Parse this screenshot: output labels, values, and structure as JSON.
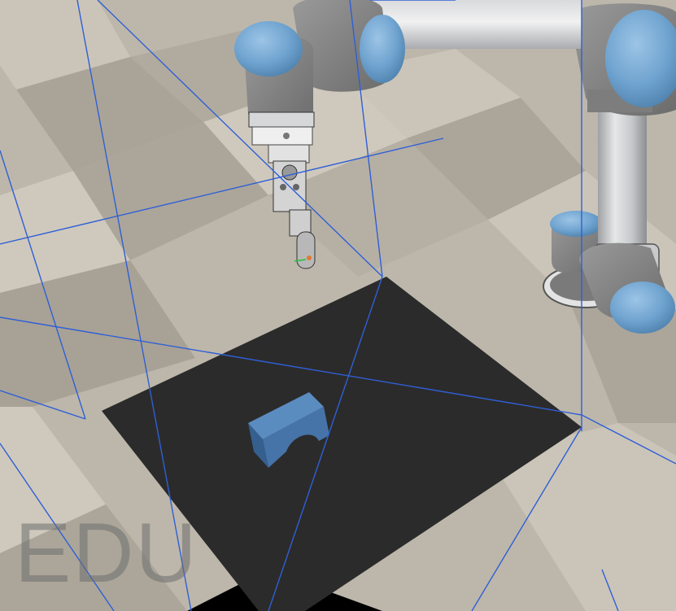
{
  "watermark": {
    "text": "EDU"
  },
  "scene": {
    "description_colors": {
      "floor_light": "#cfc9bd",
      "floor_dark": "#a9a397",
      "table": "#2b2b2b",
      "workspace_lines": "#2f5fd6",
      "robot_blue": "#6fa3cf",
      "robot_gray": "#8e8e8e",
      "robot_metal": "#cfd0d2",
      "part_blue": "#3f6fa8"
    },
    "objects": [
      {
        "name": "robot-arm"
      },
      {
        "name": "gripper"
      },
      {
        "name": "work-table"
      },
      {
        "name": "blue-part"
      },
      {
        "name": "workspace-boundary"
      }
    ]
  }
}
